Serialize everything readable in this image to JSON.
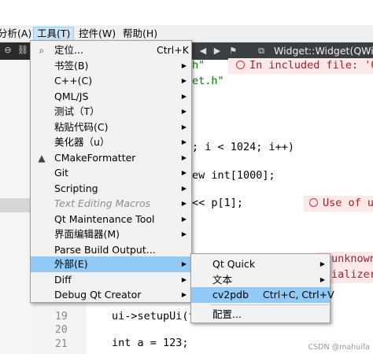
{
  "menubar": {
    "items": [
      {
        "label": "分析(A)"
      },
      {
        "label": "工具(T)"
      },
      {
        "label": "控件(W)"
      },
      {
        "label": "帮助(H)"
      }
    ]
  },
  "editor": {
    "tab_title": "Widget::Widget(QWi...",
    "lines": [
      {
        "text": "h\""
      },
      {
        "text": "et.h\""
      },
      {
        "text": "; i < 1024; i++)"
      },
      {
        "text": "ew int[1000];"
      },
      {
        "text": "<< p[1];"
      },
      {
        "text": "ui->setupUi(t"
      },
      {
        "text": "int a = 123;"
      }
    ],
    "warnings": [
      {
        "text": "In included file: 'Q"
      },
      {
        "text": "Use of u"
      },
      {
        "text": "unknown"
      },
      {
        "text": "ializer"
      }
    ],
    "line_numbers": [
      "19",
      "20",
      "21"
    ],
    "watermark": "CSDN @mahuifa"
  },
  "tools_menu": {
    "items": [
      {
        "label": "定位...",
        "shortcut": "Ctrl+K",
        "icon": "search-icon",
        "submenu": false,
        "disabled": false
      },
      {
        "label": "书签(B)",
        "submenu": true,
        "disabled": false
      },
      {
        "label": "C++(C)",
        "submenu": true,
        "disabled": false
      },
      {
        "label": "QML/JS",
        "submenu": true,
        "disabled": false
      },
      {
        "label": "测试（T）",
        "submenu": true,
        "disabled": false
      },
      {
        "label": "粘贴代码(C)",
        "submenu": true,
        "disabled": false
      },
      {
        "label": "美化器（u）",
        "submenu": true,
        "disabled": false
      },
      {
        "label": "CMakeFormatter",
        "icon": "warning-triangle-icon",
        "submenu": true,
        "disabled": false
      },
      {
        "label": "Git",
        "submenu": true,
        "disabled": false
      },
      {
        "label": "Scripting",
        "submenu": true,
        "disabled": false
      },
      {
        "label": "Text Editing Macros",
        "submenu": true,
        "disabled": true
      },
      {
        "label": "Qt Maintenance Tool",
        "submenu": true,
        "disabled": false
      },
      {
        "label": "界面编辑器(M)",
        "submenu": true,
        "disabled": false
      },
      {
        "label": "Parse Build Output...",
        "submenu": false,
        "disabled": false
      },
      {
        "label": "外部(E)",
        "submenu": true,
        "disabled": false,
        "highlighted": true
      },
      {
        "label": "Diff",
        "submenu": true,
        "disabled": false
      },
      {
        "label": "Debug Qt Creator",
        "submenu": true,
        "disabled": false
      }
    ]
  },
  "external_submenu": {
    "items": [
      {
        "label": "Qt Quick",
        "submenu": true
      },
      {
        "label": "文本",
        "submenu": true
      },
      {
        "label": "cv2pdb",
        "shortcut": "Ctrl+C, Ctrl+V",
        "highlighted": true
      },
      {
        "label": "配置..."
      }
    ]
  },
  "colors": {
    "highlight": "#91c9f7",
    "menu_bg": "#f2f2f2",
    "warning_bg": "#fde8ea"
  }
}
